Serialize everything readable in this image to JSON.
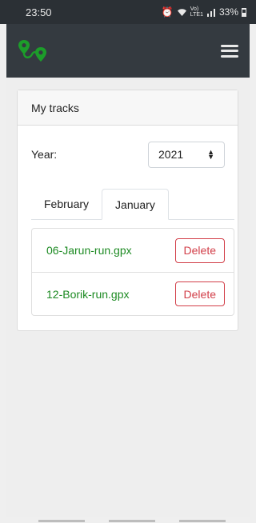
{
  "status_bar": {
    "time": "23:50",
    "indicators": "⏰ ◔ Vo) LTE1 .∥ 33%",
    "icons": [
      "alarm-icon",
      "wifi-icon",
      "lte-icon",
      "signal-icon",
      "battery-icon"
    ]
  },
  "navbar": {
    "logo_icon": "route-pins-icon",
    "menu_icon": "hamburger-menu-icon",
    "logo_color": "#1c9d2a"
  },
  "card": {
    "title": "My tracks",
    "year_label": "Year:",
    "year_value": "2021",
    "tabs": [
      {
        "label": "February",
        "active": false
      },
      {
        "label": "January",
        "active": true
      }
    ],
    "tracks": [
      {
        "name": "06-Jarun-run.gpx",
        "action": "Delete"
      },
      {
        "name": "12-Borik-run.gpx",
        "action": "Delete"
      }
    ]
  },
  "colors": {
    "navbar": "#343a40",
    "link": "#1c8a22",
    "danger": "#d23f49"
  }
}
